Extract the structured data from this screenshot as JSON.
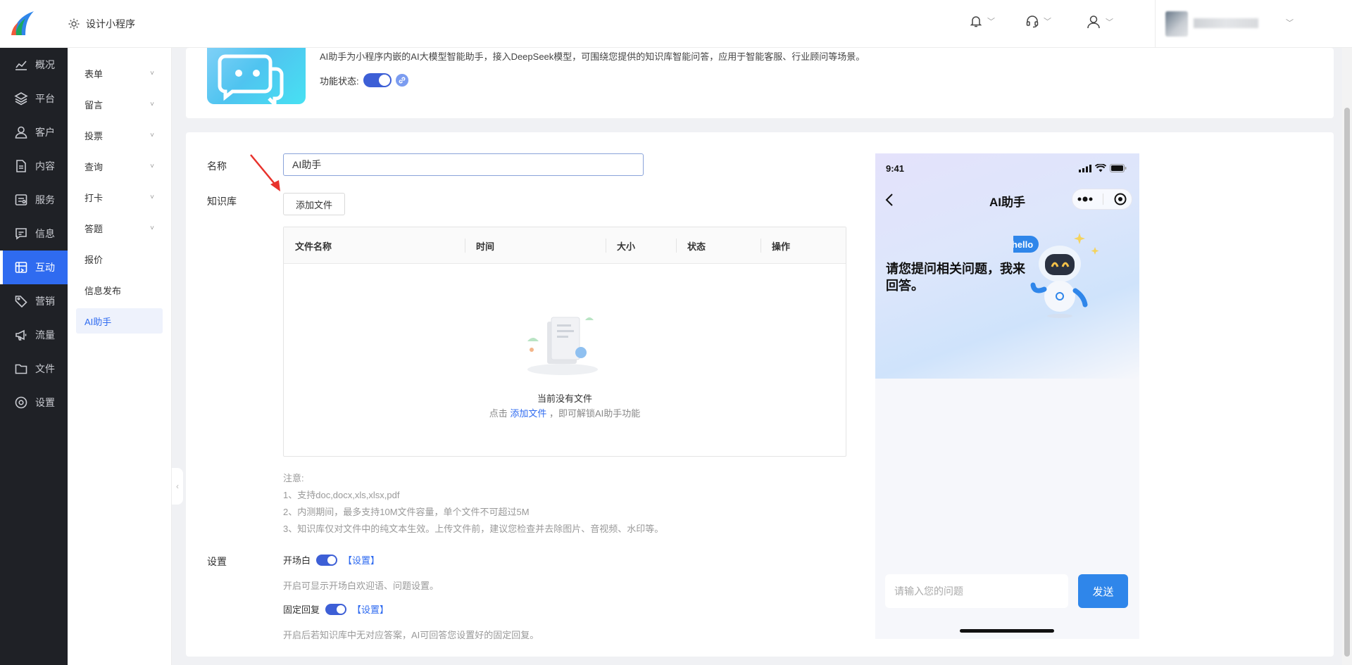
{
  "header": {
    "app_name": "设计小程序"
  },
  "mainnav": [
    {
      "label": "概况",
      "icon": "chart-line-icon"
    },
    {
      "label": "平台",
      "icon": "layers-icon"
    },
    {
      "label": "客户",
      "icon": "user-icon"
    },
    {
      "label": "内容",
      "icon": "document-icon"
    },
    {
      "label": "服务",
      "icon": "service-icon"
    },
    {
      "label": "信息",
      "icon": "message-icon"
    },
    {
      "label": "互动",
      "icon": "interaction-icon",
      "active": true
    },
    {
      "label": "营销",
      "icon": "tag-icon"
    },
    {
      "label": "流量",
      "icon": "megaphone-icon"
    },
    {
      "label": "文件",
      "icon": "folder-icon"
    },
    {
      "label": "设置",
      "icon": "gear-icon"
    }
  ],
  "subnav": [
    {
      "label": "表单",
      "arrow": "˅"
    },
    {
      "label": "留言",
      "arrow": "˅"
    },
    {
      "label": "投票",
      "arrow": "˅"
    },
    {
      "label": "查询",
      "arrow": "˅"
    },
    {
      "label": "打卡",
      "arrow": "˅"
    },
    {
      "label": "答题",
      "arrow": "˅"
    },
    {
      "label": "报价"
    },
    {
      "label": "信息发布"
    },
    {
      "label": "AI助手",
      "active": true
    }
  ],
  "intro": {
    "description": "AI助手为小程序内嵌的AI大模型智能助手，接入DeepSeek模型，可围绕您提供的知识库智能问答，应用于智能客服、行业顾问等场景。",
    "status_label": "功能状态:",
    "enabled": true
  },
  "form": {
    "name_label": "名称",
    "name_value": "AI助手",
    "kb_label": "知识库",
    "add_file_label": "添加文件",
    "table_headers": [
      "文件名称",
      "时间",
      "大小",
      "状态",
      "操作"
    ],
    "empty_title": "当前没有文件",
    "empty_hint_prefix": "点击",
    "empty_hint_link": "添加文件",
    "empty_hint_suffix": "，即可解锁AI助手功能",
    "notes": [
      "注意:",
      "1、支持doc,docx,xls,xlsx,pdf",
      "2、内测期间，最多支持10M文件容量，单个文件不可超过5M",
      "3、知识库仅对文件中的纯文本生效。上传文件前，建议您检查并去除图片、音视频、水印等。"
    ],
    "settings_label": "设置",
    "opening_label": "开场白",
    "opening_link": "【设置】",
    "opening_desc": "开启可显示开场白欢迎语、问题设置。",
    "fixed_reply_label": "固定回复",
    "fixed_reply_link": "【设置】",
    "fixed_reply_desc": "开启后若知识库中无对应答案，AI可回答您设置好的固定回复。"
  },
  "phone": {
    "time": "9:41",
    "title": "AI助手",
    "greeting": "请您提问相关问题，我来回答。",
    "robot_bubble": "hello",
    "input_placeholder": "请输入您的问题",
    "send_label": "发送"
  },
  "colors": {
    "accent": "#2f6bf0",
    "nav_bg": "#1f2126",
    "toggle_on": "#3d5fd6",
    "send_button": "#2f86ea"
  }
}
